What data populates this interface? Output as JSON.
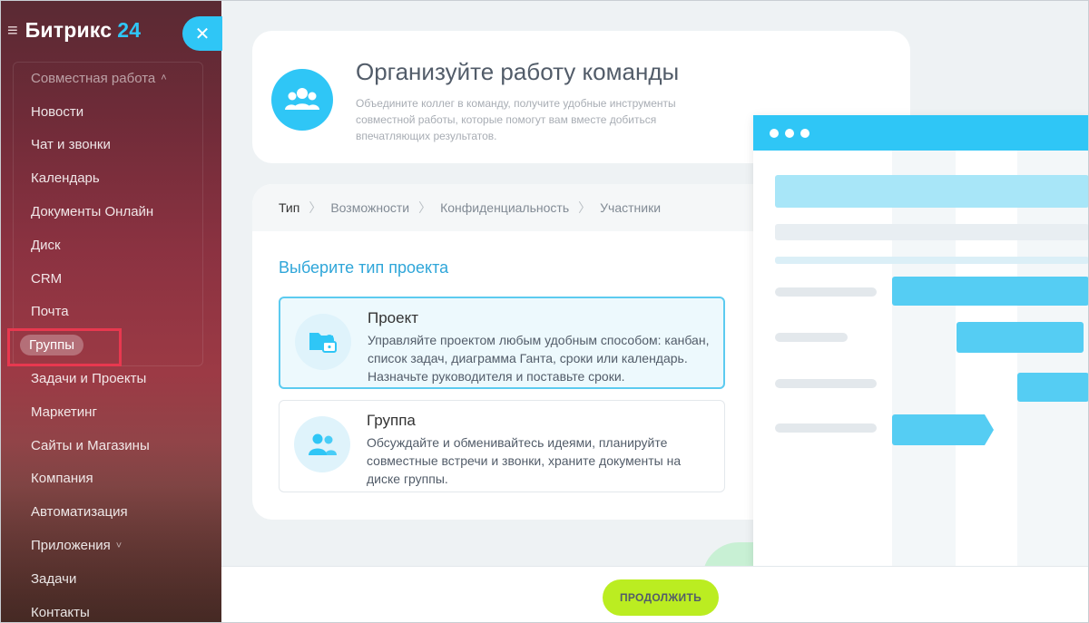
{
  "sidebar": {
    "logo": {
      "text": "Битрикс",
      "number": "24"
    },
    "menu": [
      {
        "label": "Совместная работа",
        "chevron": "˄"
      },
      {
        "label": "Новости"
      },
      {
        "label": "Чат и звонки"
      },
      {
        "label": "Календарь"
      },
      {
        "label": "Документы Онлайн"
      },
      {
        "label": "Диск"
      },
      {
        "label": "CRM"
      },
      {
        "label": "Почта"
      },
      {
        "label": "Группы"
      },
      {
        "label": "Задачи и Проекты"
      },
      {
        "label": "Маркетинг"
      },
      {
        "label": "Сайты и Магазины"
      },
      {
        "label": "Компания"
      },
      {
        "label": "Автоматизация"
      },
      {
        "label": "Приложения",
        "chevron": "˅"
      },
      {
        "label": "Задачи"
      },
      {
        "label": "Контакты"
      }
    ]
  },
  "intro": {
    "title": "Организуйте работу команды",
    "description": "Объедините коллег в команду, получите удобные инструменты совместной работы, которые помогут вам вместе добиться впечатляющих результатов."
  },
  "wizard": {
    "steps": [
      "Тип",
      "Возможности",
      "Конфиденциальность",
      "Участники"
    ],
    "title": "Выберите тип проекта",
    "options": [
      {
        "title": "Проект",
        "description": "Управляйте проектом любым удобным способом: канбан, список задач, диаграмма Ганта, сроки или календарь. Назначьте руководителя и поставьте сроки."
      },
      {
        "title": "Группа",
        "description": "Обсуждайте и обменивайтесь идеями, планируйте совместные встречи и звонки, храните документы на диске группы."
      }
    ]
  },
  "footer": {
    "continue_label": "ПРОДОЛЖИТЬ"
  },
  "colors": {
    "accent": "#2fc6f6",
    "continue": "#bbed21",
    "highlight": "#e8384f"
  }
}
